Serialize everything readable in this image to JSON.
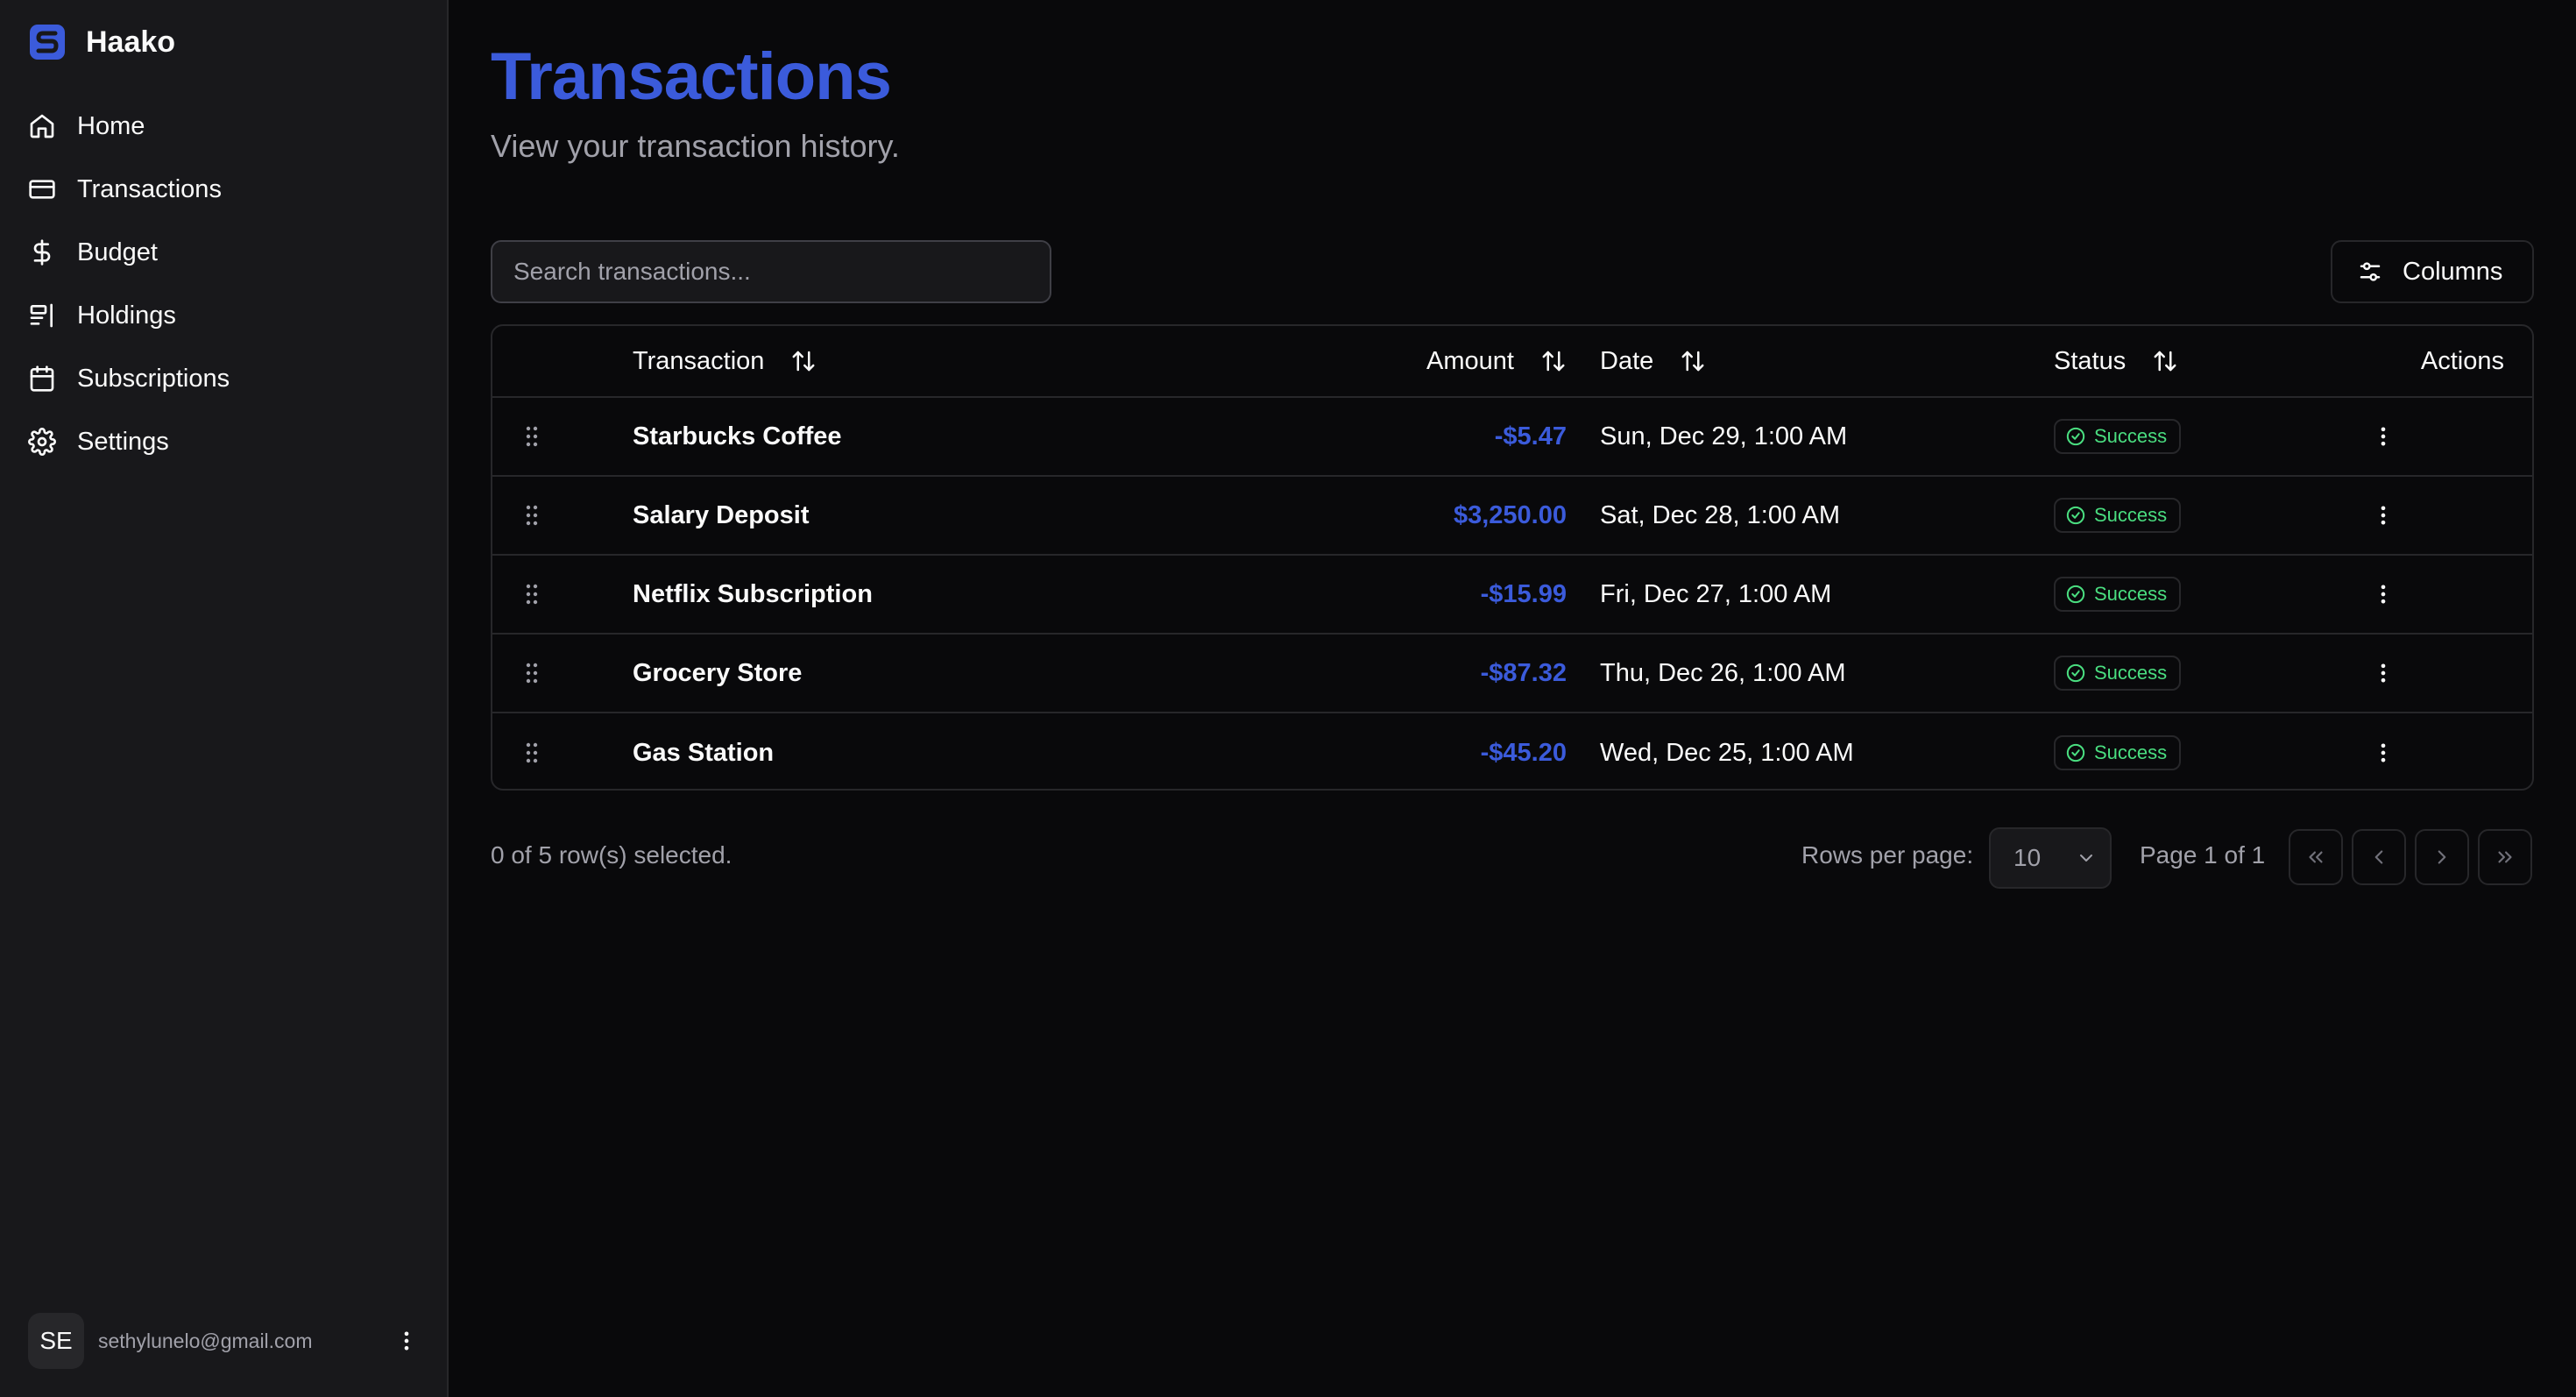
{
  "app": {
    "name": "Haako"
  },
  "sidebar": {
    "items": [
      {
        "label": "Home",
        "icon": "home-icon"
      },
      {
        "label": "Transactions",
        "icon": "credit-card-icon"
      },
      {
        "label": "Budget",
        "icon": "dollar-icon"
      },
      {
        "label": "Holdings",
        "icon": "holdings-icon"
      },
      {
        "label": "Subscriptions",
        "icon": "calendar-icon"
      },
      {
        "label": "Settings",
        "icon": "gear-icon"
      }
    ],
    "user": {
      "initials": "SE",
      "email": "sethylunelo@gmail.com"
    }
  },
  "page": {
    "title": "Transactions",
    "subtitle": "View your transaction history.",
    "search_placeholder": "Search transactions...",
    "columns_label": "Columns"
  },
  "table": {
    "headers": {
      "transaction": "Transaction",
      "amount": "Amount",
      "date": "Date",
      "status": "Status",
      "actions": "Actions"
    },
    "rows": [
      {
        "name": "Starbucks Coffee",
        "amount": "-$5.47",
        "date": "Sun, Dec 29, 1:00 AM",
        "status": "Success"
      },
      {
        "name": "Salary Deposit",
        "amount": "$3,250.00",
        "date": "Sat, Dec 28, 1:00 AM",
        "status": "Success"
      },
      {
        "name": "Netflix Subscription",
        "amount": "-$15.99",
        "date": "Fri, Dec 27, 1:00 AM",
        "status": "Success"
      },
      {
        "name": "Grocery Store",
        "amount": "-$87.32",
        "date": "Thu, Dec 26, 1:00 AM",
        "status": "Success"
      },
      {
        "name": "Gas Station",
        "amount": "-$45.20",
        "date": "Wed, Dec 25, 1:00 AM",
        "status": "Success"
      }
    ]
  },
  "footer": {
    "selection": "0 of 5 row(s) selected.",
    "rows_per_page_label": "Rows per page:",
    "rows_per_page_value": "10",
    "page_info": "Page 1 of 1"
  },
  "colors": {
    "accent": "#3b5bdb",
    "success": "#4ade80",
    "background": "#09090b",
    "sidebar": "#18181b"
  }
}
